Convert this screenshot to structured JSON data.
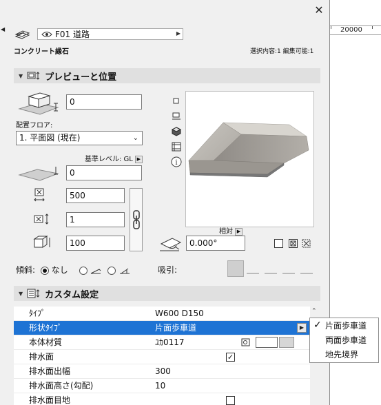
{
  "ruler": {
    "value": "20000"
  },
  "header": {
    "layer_name": "F01 道路",
    "object_name": "コンクリート縁石",
    "selection_info": "選択内容:1 編集可能:1"
  },
  "preview_section": {
    "title": "プレビューと位置",
    "height_value": "0",
    "floor_label": "配置フロア:",
    "floor_value": "1. 平面図 (現在)",
    "ref_level_label": "基準レベル: GL",
    "offset_value": "0",
    "width_value": "500",
    "count_value": "1",
    "depth_value": "100",
    "relative_label": "相対",
    "angle_value": "0.000°",
    "slope_label": "傾斜:",
    "slope_none": "なし",
    "snap_label": "吸引:"
  },
  "custom_section": {
    "title": "カスタム設定",
    "rows": [
      {
        "name": "ﾀｲﾌﾟ",
        "value": "W600 D150"
      },
      {
        "name": "形状ﾀｲﾌﾟ",
        "value": "片面歩車道"
      },
      {
        "name": "本体材質",
        "value": "ﾕｶ0117"
      },
      {
        "name": "排水面",
        "value": ""
      },
      {
        "name": "排水面出幅",
        "value": "300"
      },
      {
        "name": "排水面高さ(勾配)",
        "value": "10"
      },
      {
        "name": "排水面目地",
        "value": ""
      }
    ]
  },
  "shape_popup": {
    "options": [
      "片面歩車道",
      "両面歩車道",
      "地先境界"
    ],
    "selected": "片面歩車道"
  }
}
